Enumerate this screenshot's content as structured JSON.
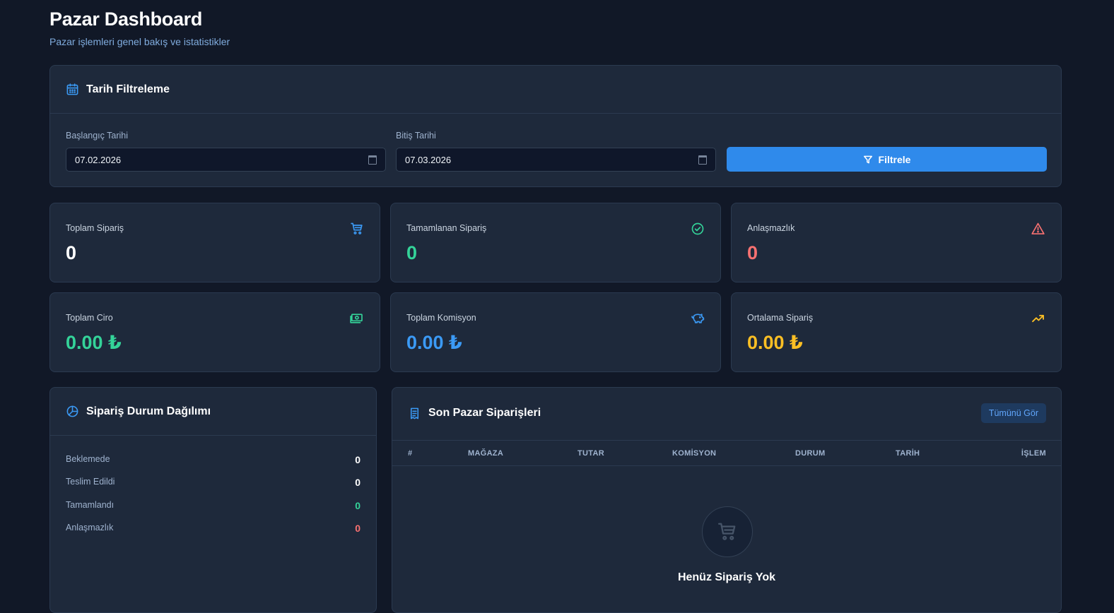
{
  "page": {
    "title": "Pazar Dashboard",
    "subtitle": "Pazar işlemleri genel bakış ve istatistikler"
  },
  "filter": {
    "title": "Tarih Filtreleme",
    "start_label": "Başlangıç Tarihi",
    "start_value": "07.02.2026",
    "end_label": "Bitiş Tarihi",
    "end_value": "07.03.2026",
    "button_label": "Filtrele"
  },
  "stats": [
    {
      "label": "Toplam Sipariş",
      "value": "0",
      "icon": "cart-icon",
      "color": "#ffffff",
      "icon_color": "#3b9af5"
    },
    {
      "label": "Tamamlanan Sipariş",
      "value": "0",
      "icon": "check-circle-icon",
      "color": "#34d399",
      "icon_color": "#34d399"
    },
    {
      "label": "Anlaşmazlık",
      "value": "0",
      "icon": "warning-icon",
      "color": "#f87171",
      "icon_color": "#f87171"
    },
    {
      "label": "Toplam Ciro",
      "value": "0.00 ₺",
      "icon": "money-icon",
      "color": "#34d399",
      "icon_color": "#34d399"
    },
    {
      "label": "Toplam Komisyon",
      "value": "0.00 ₺",
      "icon": "piggy-bank-icon",
      "color": "#3b9af5",
      "icon_color": "#3b9af5"
    },
    {
      "label": "Ortalama Sipariş",
      "value": "0.00 ₺",
      "icon": "trending-up-icon",
      "color": "#fbbf24",
      "icon_color": "#fbbf24"
    }
  ],
  "distribution": {
    "title": "Sipariş Durum Dağılımı",
    "rows": [
      {
        "label": "Beklemede",
        "value": "0",
        "color": "#ffffff"
      },
      {
        "label": "Teslim Edildi",
        "value": "0",
        "color": "#ffffff"
      },
      {
        "label": "Tamamlandı",
        "value": "0",
        "color": "#34d399"
      },
      {
        "label": "Anlaşmazlık",
        "value": "0",
        "color": "#f87171"
      }
    ]
  },
  "orders": {
    "title": "Son Pazar Siparişleri",
    "view_all": "Tümünü Gör",
    "columns": [
      "#",
      "MAĞAZA",
      "TUTAR",
      "KOMİSYON",
      "DURUM",
      "TARİH",
      "İŞLEM"
    ],
    "empty_title": "Henüz Sipariş Yok",
    "empty_subtitle": ""
  },
  "colors": {
    "background": "#111827",
    "card": "#1e293b",
    "accent": "#2f8aeb"
  }
}
